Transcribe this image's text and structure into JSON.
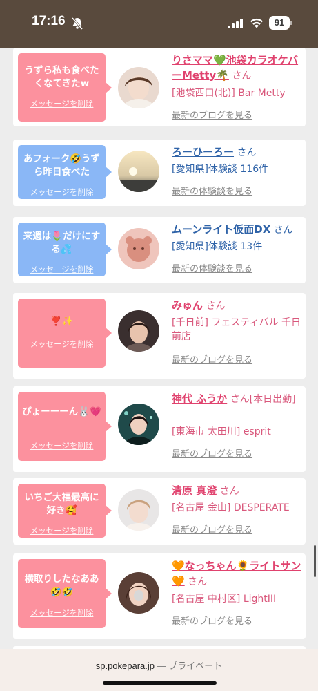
{
  "status_bar": {
    "time": "17:16",
    "battery": "91"
  },
  "cards": [
    {
      "message": "うずら私も食べたくなてきたw",
      "delete_label": "メッセージを削除",
      "name": "りさママ💚池袋カラオケバーMetty🌴",
      "san": "さん",
      "meta": "[池袋西口(北)] Bar Metty",
      "more": "最新のブログを見る"
    },
    {
      "message": "あフォーク🤣うずら昨日食べた",
      "delete_label": "メッセージを削除",
      "name": "ろーひーろー",
      "san": "さん",
      "meta": "[愛知県]体験談 116件",
      "more": "最新の体験談を見る"
    },
    {
      "message": "来週は🌷だけにする💦",
      "delete_label": "メッセージを削除",
      "name": "ムーンライト仮面DX",
      "san": "さん",
      "meta": "[愛知県]体験談 13件",
      "more": "最新の体験談を見る"
    },
    {
      "message": "❣️✨",
      "delete_label": "メッセージを削除",
      "name": "みゅん",
      "san": "さん",
      "meta": "[千日前] フェスティバル 千日前店",
      "more": "最新のブログを見る"
    },
    {
      "message": "ぴょーーーん🐰💗",
      "delete_label": "メッセージを削除",
      "name": "神代 ふうか",
      "san": "さん[本日出勤]",
      "meta": "[東海市 太田川] esprit",
      "more": "最新のブログを見る"
    },
    {
      "message": "いちご大福最高に好き🥰",
      "delete_label": "メッセージを削除",
      "name": "清原 真澄",
      "san": "さん",
      "meta": "[名古屋 金山] DESPERATE",
      "more": "最新のブログを見る"
    },
    {
      "message": "横取りしたなああ🤣🤣",
      "delete_label": "メッセージを削除",
      "name": "🧡なっちゃん🌻ライトサン🧡",
      "san": "さん",
      "meta": "[名古屋 中村区] LightIII",
      "more": "最新のブログを見る"
    }
  ],
  "url_bar": {
    "domain": "sp.pokepara.jp",
    "separator": " — ",
    "mode": "プライベート"
  }
}
